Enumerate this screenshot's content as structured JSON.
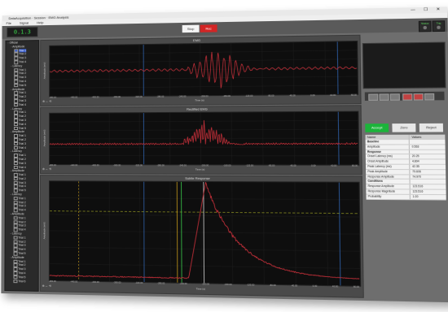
{
  "window": {
    "title": "DataAcquisition · Session · EMG Analysis",
    "controls": "— ☐ ✕"
  },
  "menu": [
    "File",
    "Signal",
    "Help"
  ],
  "toolbar": {
    "counter": "0.1.3",
    "stop_label": "Stop",
    "record_label": "Rec",
    "led1": "Status",
    "led2": "Trig"
  },
  "tree": {
    "items": [
      {
        "label": "- Official",
        "level": 0
      },
      {
        "label": "- Amplitude",
        "level": 1
      },
      {
        "label": "Trial 1",
        "level": 2,
        "selected": true
      },
      {
        "label": "Trial 2",
        "level": 2
      },
      {
        "label": "Trial 3",
        "level": 2
      },
      {
        "label": "Trial 4",
        "level": 2
      },
      {
        "label": "- Latency",
        "level": 1
      },
      {
        "label": "Trial 1",
        "level": 2
      },
      {
        "label": "Trial 2",
        "level": 2
      },
      {
        "label": "Trial 3",
        "level": 2
      },
      {
        "label": "Trial 4",
        "level": 2
      },
      {
        "label": "Trial 5",
        "level": 2
      },
      {
        "label": "- Amplitude",
        "level": 1
      },
      {
        "label": "Trial 1",
        "level": 2
      },
      {
        "label": "Trial 2",
        "level": 2
      },
      {
        "label": "Trial 3",
        "level": 2
      },
      {
        "label": "Trial 4",
        "level": 2
      },
      {
        "label": "- Latency",
        "level": 1
      },
      {
        "label": "Trial 1",
        "level": 2
      },
      {
        "label": "Trial 2",
        "level": 2
      },
      {
        "label": "Trial 3",
        "level": 2
      },
      {
        "label": "Trial 4",
        "level": 2
      },
      {
        "label": "Trial 5",
        "level": 2
      },
      {
        "label": "- Amplitude",
        "level": 1
      },
      {
        "label": "Trial 1",
        "level": 2
      },
      {
        "label": "Trial 2",
        "level": 2
      },
      {
        "label": "Trial 3",
        "level": 2
      },
      {
        "label": "Trial 4",
        "level": 2
      },
      {
        "label": "- Latency",
        "level": 1
      },
      {
        "label": "Trial 1",
        "level": 2
      },
      {
        "label": "Trial 2",
        "level": 2
      },
      {
        "label": "Trial 3",
        "level": 2
      },
      {
        "label": "Trial 4",
        "level": 2
      },
      {
        "label": "- Amplitude",
        "level": 1
      },
      {
        "label": "Trial 1",
        "level": 2
      },
      {
        "label": "Trial 2",
        "level": 2
      },
      {
        "label": "Trial 3",
        "level": 2
      },
      {
        "label": "Trial 4",
        "level": 2
      },
      {
        "label": "Trial 5",
        "level": 2
      },
      {
        "label": "- Latency",
        "level": 1
      },
      {
        "label": "Trial 1",
        "level": 2
      },
      {
        "label": "Trial 2",
        "level": 2
      },
      {
        "label": "Trial 3",
        "level": 2
      },
      {
        "label": "Trial 4",
        "level": 2
      },
      {
        "label": "- Amplitude",
        "level": 1
      },
      {
        "label": "Trial 1",
        "level": 2
      },
      {
        "label": "Trial 2",
        "level": 2
      },
      {
        "label": "Trial 3",
        "level": 2
      },
      {
        "label": "Trial 4",
        "level": 2
      },
      {
        "label": "- Latency",
        "level": 1
      },
      {
        "label": "Trial 1",
        "level": 2
      },
      {
        "label": "Trial 2",
        "level": 2
      },
      {
        "label": "Trial 3",
        "level": 2
      },
      {
        "label": "Trial 4",
        "level": 2
      },
      {
        "label": "Trial 5",
        "level": 2
      },
      {
        "label": "- Amplitude",
        "level": 1
      },
      {
        "label": "Trial 1",
        "level": 2
      },
      {
        "label": "Trial 2",
        "level": 2
      },
      {
        "label": "Trial 3",
        "level": 2
      },
      {
        "label": "Trial 4",
        "level": 2
      },
      {
        "label": "Trial 5",
        "level": 2
      },
      {
        "label": "Trial 6",
        "level": 2
      }
    ]
  },
  "plots": {
    "emg": {
      "title": "EMG",
      "xlabel": "Time (s)",
      "ylabel": "Amplitude (mV)"
    },
    "rect": {
      "title": "Rectified EMG",
      "xlabel": "Time (s)",
      "ylabel": "Amplitude (mV)"
    },
    "resp": {
      "title": "Subtle Response",
      "xlabel": "Time (s)",
      "ylabel": "Amplitude (mV)"
    },
    "toolbar_icons": "⊕ ↔ ⟲",
    "xticks": [
      "-480.00",
      "-460.00",
      "-440.00",
      "-420.00",
      "-400.00",
      "-380.00",
      "-360.00",
      "-340.00",
      "-320.00",
      "-300.00",
      "-280.00",
      "-260.00",
      "-240.00",
      "-220.00",
      "-200.00",
      "-180.00",
      "-160.00",
      "-140.00",
      "-120.00",
      "-100.00",
      "-80.00",
      "-60.00",
      "-40.00",
      "-20.00",
      "0.00",
      "20.00",
      "40.00",
      "60.00",
      "80.00",
      "100.00"
    ],
    "trace_color": "#c8303a",
    "marker_colors": {
      "cursor": "#3a7ad8",
      "onset": "#d4a41c",
      "green": "#39c54a",
      "white": "#e6e6e6",
      "threshold": "#c6cc2a"
    }
  },
  "right": {
    "buttons": {
      "accept": "Accept",
      "zero": "Zero",
      "reject": "Reject"
    },
    "table": {
      "headers": [
        "Name",
        "Values"
      ],
      "rows": [
        {
          "name": "Baseline",
          "value": "",
          "group": true
        },
        {
          "name": "Amplitude",
          "value": "0.563",
          "group": false
        },
        {
          "name": "Response",
          "value": "",
          "group": true
        },
        {
          "name": "Onset Latency (ms)",
          "value": "20.25",
          "group": false
        },
        {
          "name": "Onset Amplitude",
          "value": "4.804",
          "group": false
        },
        {
          "name": "Peak Latency (ms)",
          "value": "42.35",
          "group": false
        },
        {
          "name": "Peak Amplitude",
          "value": "79.606",
          "group": false
        },
        {
          "name": "Response Amplitude",
          "value": "74.970",
          "group": false
        },
        {
          "name": "Conditions",
          "value": "",
          "group": true
        },
        {
          "name": "Response Amplitude",
          "value": "123.516",
          "group": false
        },
        {
          "name": "Response Magnitude",
          "value": "123.516",
          "group": false
        },
        {
          "name": "Probability",
          "value": "1.00",
          "group": false
        }
      ]
    }
  }
}
